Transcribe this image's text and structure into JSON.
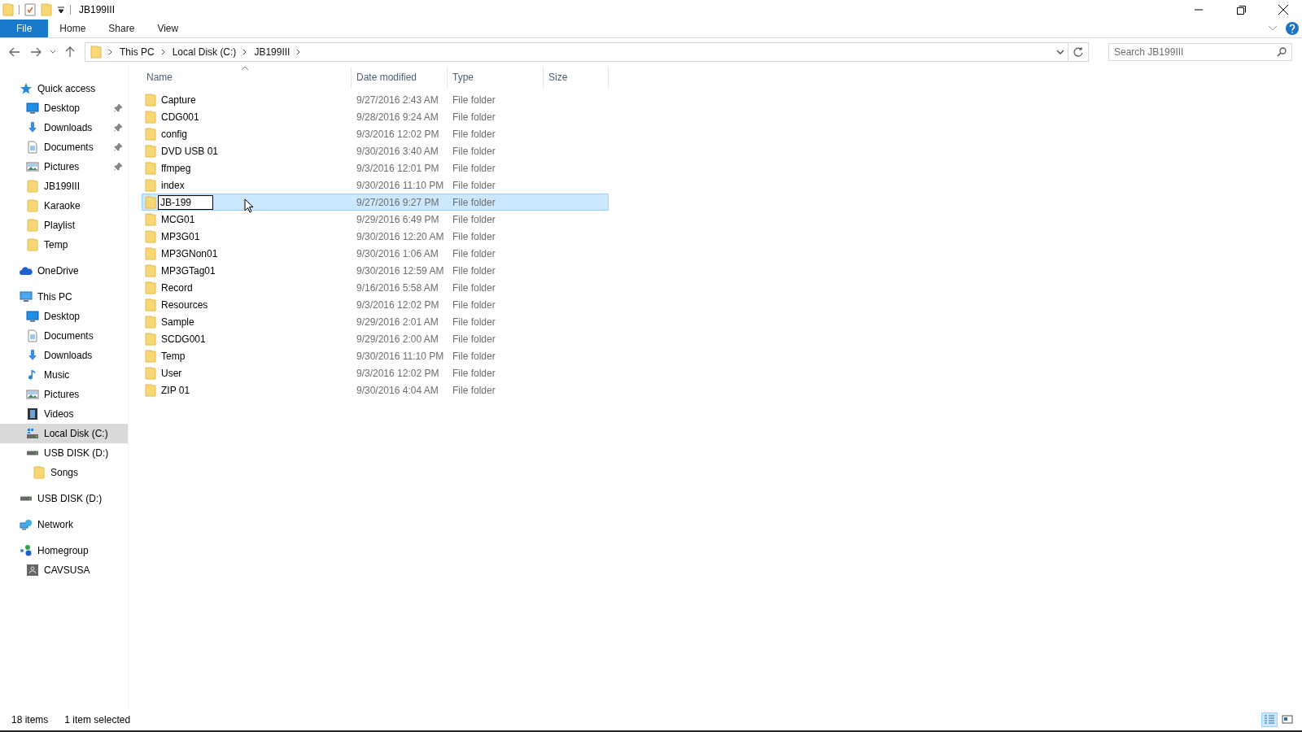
{
  "window": {
    "title": "JB199III"
  },
  "ribbon_tabs": [
    {
      "label": "File",
      "selected": true
    },
    {
      "label": "Home",
      "selected": false
    },
    {
      "label": "Share",
      "selected": false
    },
    {
      "label": "View",
      "selected": false
    }
  ],
  "address": {
    "crumbs": [
      "This PC",
      "Local Disk (C:)",
      "JB199III"
    ]
  },
  "search": {
    "placeholder": "Search JB199III"
  },
  "sidebar": {
    "items": [
      {
        "label": "Quick access",
        "kind": "star",
        "selected": false,
        "children": [
          {
            "label": "Desktop",
            "kind": "desktop",
            "pinned": true,
            "selected": false
          },
          {
            "label": "Downloads",
            "kind": "download",
            "pinned": true,
            "selected": false
          },
          {
            "label": "Documents",
            "kind": "document",
            "pinned": true,
            "selected": false
          },
          {
            "label": "Pictures",
            "kind": "pictures",
            "pinned": true,
            "selected": false
          },
          {
            "label": "JB199III",
            "kind": "folder",
            "pinned": false,
            "selected": false
          },
          {
            "label": "Karaoke",
            "kind": "folder",
            "pinned": false,
            "selected": false
          },
          {
            "label": "Playlist",
            "kind": "folder",
            "pinned": false,
            "selected": false
          },
          {
            "label": "Temp",
            "kind": "folder",
            "pinned": false,
            "selected": false
          }
        ]
      },
      {
        "label": "OneDrive",
        "kind": "cloud",
        "selected": false
      },
      {
        "label": "This PC",
        "kind": "pc",
        "selected": false,
        "children": [
          {
            "label": "Desktop",
            "kind": "desktop",
            "selected": false
          },
          {
            "label": "Documents",
            "kind": "document",
            "selected": false
          },
          {
            "label": "Downloads",
            "kind": "download",
            "selected": false
          },
          {
            "label": "Music",
            "kind": "music",
            "selected": false
          },
          {
            "label": "Pictures",
            "kind": "pictures",
            "selected": false
          },
          {
            "label": "Videos",
            "kind": "videos",
            "selected": false
          },
          {
            "label": "Local Disk (C:)",
            "kind": "windrive",
            "selected": true
          },
          {
            "label": "USB DISK (D:)",
            "kind": "drive",
            "selected": false,
            "children": [
              {
                "label": "Songs",
                "kind": "folder",
                "selected": false
              }
            ]
          }
        ]
      },
      {
        "label": "USB DISK (D:)",
        "kind": "drive",
        "selected": false
      },
      {
        "label": "Network",
        "kind": "network",
        "selected": false
      },
      {
        "label": "Homegroup",
        "kind": "homegroup",
        "selected": false,
        "children": [
          {
            "label": "CAVSUSA",
            "kind": "user",
            "selected": false
          }
        ]
      }
    ]
  },
  "table": {
    "columns": [
      "Name",
      "Date modified",
      "Type",
      "Size"
    ],
    "rows": [
      {
        "name": "Capture",
        "date": "9/27/2016 2:43 AM",
        "type": "File folder",
        "selected": false,
        "renaming": false
      },
      {
        "name": "CDG001",
        "date": "9/28/2016 9:24 AM",
        "type": "File folder",
        "selected": false,
        "renaming": false
      },
      {
        "name": "config",
        "date": "9/3/2016 12:02 PM",
        "type": "File folder",
        "selected": false,
        "renaming": false
      },
      {
        "name": "DVD USB 01",
        "date": "9/30/2016 3:40 AM",
        "type": "File folder",
        "selected": false,
        "renaming": false
      },
      {
        "name": "ffmpeg",
        "date": "9/3/2016 12:01 PM",
        "type": "File folder",
        "selected": false,
        "renaming": false
      },
      {
        "name": "index",
        "date": "9/30/2016 11:10 PM",
        "type": "File folder",
        "selected": false,
        "renaming": false
      },
      {
        "name": "JB-199",
        "date": "9/27/2016 9:27 PM",
        "type": "File folder",
        "selected": true,
        "renaming": true
      },
      {
        "name": "MCG01",
        "date": "9/29/2016 6:49 PM",
        "type": "File folder",
        "selected": false,
        "renaming": false
      },
      {
        "name": "MP3G01",
        "date": "9/30/2016 12:20 AM",
        "type": "File folder",
        "selected": false,
        "renaming": false
      },
      {
        "name": "MP3GNon01",
        "date": "9/30/2016 1:06 AM",
        "type": "File folder",
        "selected": false,
        "renaming": false
      },
      {
        "name": "MP3GTag01",
        "date": "9/30/2016 12:59 AM",
        "type": "File folder",
        "selected": false,
        "renaming": false
      },
      {
        "name": "Record",
        "date": "9/16/2016 5:58 AM",
        "type": "File folder",
        "selected": false,
        "renaming": false
      },
      {
        "name": "Resources",
        "date": "9/3/2016 12:02 PM",
        "type": "File folder",
        "selected": false,
        "renaming": false
      },
      {
        "name": "Sample",
        "date": "9/29/2016 2:01 AM",
        "type": "File folder",
        "selected": false,
        "renaming": false
      },
      {
        "name": "SCDG001",
        "date": "9/29/2016 2:00 AM",
        "type": "File folder",
        "selected": false,
        "renaming": false
      },
      {
        "name": "Temp",
        "date": "9/30/2016 11:10 PM",
        "type": "File folder",
        "selected": false,
        "renaming": false
      },
      {
        "name": "User",
        "date": "9/3/2016 12:02 PM",
        "type": "File folder",
        "selected": false,
        "renaming": false
      },
      {
        "name": "ZIP 01",
        "date": "9/30/2016 4:04 AM",
        "type": "File folder",
        "selected": false,
        "renaming": false
      }
    ]
  },
  "status_bar": {
    "count": "18 items",
    "selection": "1 item selected"
  },
  "view_buttons": [
    {
      "kind": "details",
      "selected": true
    },
    {
      "kind": "large",
      "selected": false
    }
  ]
}
